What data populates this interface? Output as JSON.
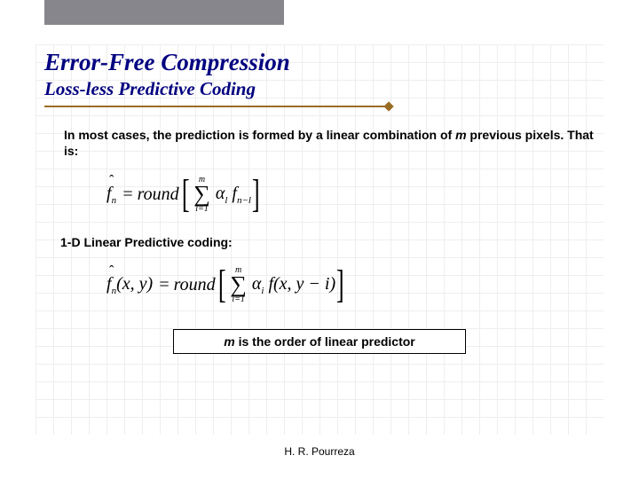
{
  "title": "Error-Free Compression",
  "subtitle": "Loss-less Predictive Coding",
  "paragraph": {
    "pre": "In most cases, the prediction is formed by a linear combination of ",
    "m": "m",
    "post": " previous pixels. That is:"
  },
  "formula1": {
    "lhs_var": "f",
    "lhs_sub": "n",
    "eq": "=",
    "round": "round",
    "sum_top": "m",
    "sum_bot": "l=1",
    "alpha": "α",
    "alpha_sub": "l",
    "f": "f",
    "f_sub": "n−l"
  },
  "section": "1-D Linear Predictive coding:",
  "formula2": {
    "lhs_var": "f",
    "lhs_sub": "n",
    "lhs_args": "(x, y)",
    "eq": "=",
    "round": "round",
    "sum_top": "m",
    "sum_bot": "i=1",
    "alpha": "α",
    "alpha_sub": "i",
    "f": "f",
    "f_args": "(x, y − i)"
  },
  "note": {
    "m": "m",
    "rest": " is the order of linear predictor"
  },
  "footer": "H. R. Pourreza"
}
